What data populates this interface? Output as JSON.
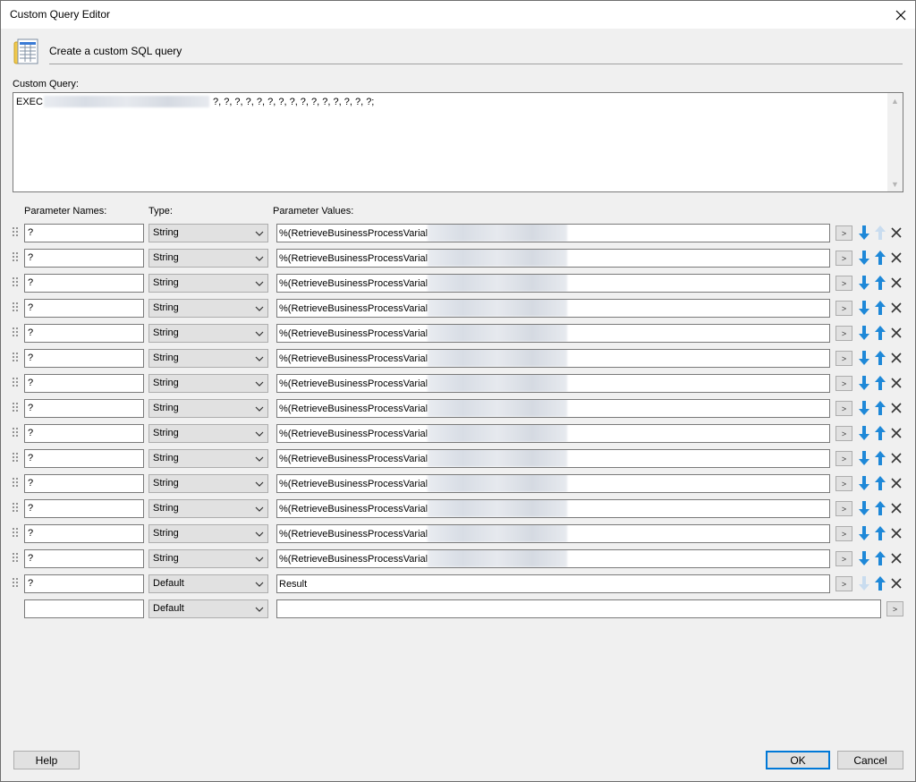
{
  "window": {
    "title": "Custom Query Editor"
  },
  "header": {
    "text": "Create a custom SQL query",
    "icon": "database-table-icon"
  },
  "query": {
    "label": "Custom Query:",
    "prefix": "EXEC",
    "suffix": "?, ?, ?, ?, ?, ?, ?, ?, ?, ?, ?, ?, ?, ?, ?;"
  },
  "columns": {
    "names": "Parameter Names:",
    "type": "Type:",
    "values": "Parameter Values:"
  },
  "params": [
    {
      "name": "?",
      "type": "String",
      "value": "%(RetrieveBusinessProcessVarial",
      "down": true,
      "up": false
    },
    {
      "name": "?",
      "type": "String",
      "value": "%(RetrieveBusinessProcessVarial",
      "down": true,
      "up": true
    },
    {
      "name": "?",
      "type": "String",
      "value": "%(RetrieveBusinessProcessVarial",
      "down": true,
      "up": true
    },
    {
      "name": "?",
      "type": "String",
      "value": "%(RetrieveBusinessProcessVarial",
      "down": true,
      "up": true
    },
    {
      "name": "?",
      "type": "String",
      "value": "%(RetrieveBusinessProcessVarial",
      "down": true,
      "up": true
    },
    {
      "name": "?",
      "type": "String",
      "value": "%(RetrieveBusinessProcessVarial",
      "down": true,
      "up": true
    },
    {
      "name": "?",
      "type": "String",
      "value": "%(RetrieveBusinessProcessVarial",
      "down": true,
      "up": true
    },
    {
      "name": "?",
      "type": "String",
      "value": "%(RetrieveBusinessProcessVarial",
      "down": true,
      "up": true
    },
    {
      "name": "?",
      "type": "String",
      "value": "%(RetrieveBusinessProcessVarial",
      "down": true,
      "up": true
    },
    {
      "name": "?",
      "type": "String",
      "value": "%(RetrieveBusinessProcessVarial",
      "down": true,
      "up": true
    },
    {
      "name": "?",
      "type": "String",
      "value": "%(RetrieveBusinessProcessVarial",
      "down": true,
      "up": true
    },
    {
      "name": "?",
      "type": "String",
      "value": "%(RetrieveBusinessProcessVarial",
      "down": true,
      "up": true
    },
    {
      "name": "?",
      "type": "String",
      "value": "%(RetrieveBusinessProcessVarial",
      "down": true,
      "up": true
    },
    {
      "name": "?",
      "type": "String",
      "value": "%(RetrieveBusinessProcessVarial",
      "down": true,
      "up": true
    },
    {
      "name": "?",
      "type": "Default",
      "value": "Result",
      "down": false,
      "up": true
    }
  ],
  "newRow": {
    "name": "",
    "type": "Default",
    "value": ""
  },
  "browse_label": ">",
  "buttons": {
    "help": "Help",
    "ok": "OK",
    "cancel": "Cancel"
  },
  "colors": {
    "arrow_active": "#1e88d8",
    "arrow_disabled": "#c9dcef",
    "accent": "#0078d7"
  }
}
